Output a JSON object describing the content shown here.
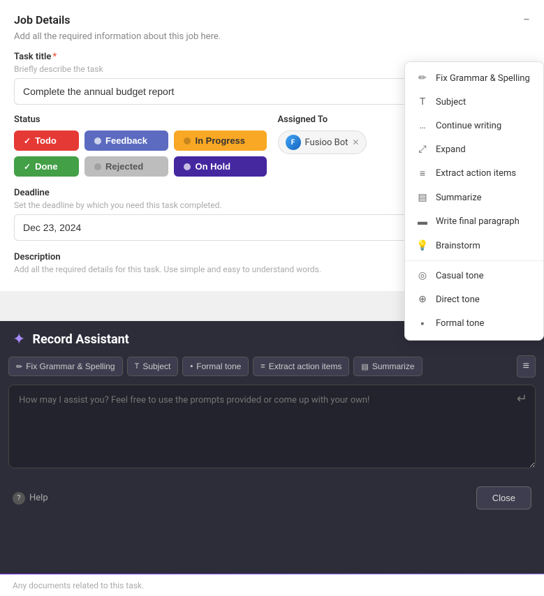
{
  "panel": {
    "title": "Job Details",
    "subtitle": "Add all the required information about this job here.",
    "task_title_label": "Task title",
    "task_title_hint": "Briefly describe the task",
    "task_title_value": "Complete the annual budget report",
    "status_label": "Status",
    "assigned_label": "Assigned To",
    "deadline_label": "Deadline",
    "deadline_hint": "Set the deadline by which you need this task completed.",
    "deadline_value": "Dec 23, 2024",
    "description_label": "Description",
    "description_hint": "Add all the required details for this task. Use simple and easy to understand words."
  },
  "status_buttons": [
    {
      "id": "todo",
      "label": "Todo",
      "class": "btn-todo"
    },
    {
      "id": "feedback",
      "label": "Feedback",
      "class": "btn-feedback"
    },
    {
      "id": "inprogress",
      "label": "In Progress",
      "class": "btn-inprogress"
    },
    {
      "id": "done",
      "label": "Done",
      "class": "btn-done"
    },
    {
      "id": "rejected",
      "label": "Rejected",
      "class": "btn-rejected"
    },
    {
      "id": "onhold",
      "label": "On Hold",
      "class": "btn-onhold"
    }
  ],
  "assigned": {
    "chip_label": "Fusioo Bot"
  },
  "dropdown": {
    "items": [
      {
        "id": "fix-grammar",
        "label": "Fix Grammar & Spelling",
        "icon": "✏"
      },
      {
        "id": "subject",
        "label": "Subject",
        "icon": "T"
      },
      {
        "id": "continue-writing",
        "label": "Continue writing",
        "icon": "…"
      },
      {
        "id": "expand",
        "label": "Expand",
        "icon": "⤢"
      },
      {
        "id": "extract-action-items",
        "label": "Extract action items",
        "icon": "≡"
      },
      {
        "id": "summarize",
        "label": "Summarize",
        "icon": "▤"
      },
      {
        "id": "write-final-paragraph",
        "label": "Write final paragraph",
        "icon": "▬"
      },
      {
        "id": "brainstorm",
        "label": "Brainstorm",
        "icon": "💡"
      },
      {
        "id": "casual-tone",
        "label": "Casual tone",
        "icon": "◎"
      },
      {
        "id": "direct-tone",
        "label": "Direct tone",
        "icon": "⊕"
      },
      {
        "id": "formal-tone",
        "label": "Formal tone",
        "icon": "▪"
      }
    ]
  },
  "assistant": {
    "title": "Record Assistant",
    "placeholder": "How may I assist you? Feel free to use the prompts provided or come up with your own!",
    "toolbar_items": [
      {
        "id": "fix-grammar",
        "label": "Fix Grammar & Spelling",
        "icon": "✏"
      },
      {
        "id": "subject",
        "label": "Subject",
        "icon": "T"
      },
      {
        "id": "formal-tone",
        "label": "Formal tone",
        "icon": "▪"
      },
      {
        "id": "extract-action-items",
        "label": "Extract action items",
        "icon": "≡"
      },
      {
        "id": "summarize",
        "label": "Summarize",
        "icon": "▤"
      }
    ],
    "help_label": "Help",
    "close_label": "Close"
  },
  "bottom_bar": {
    "text": "Any documents related to this task."
  }
}
